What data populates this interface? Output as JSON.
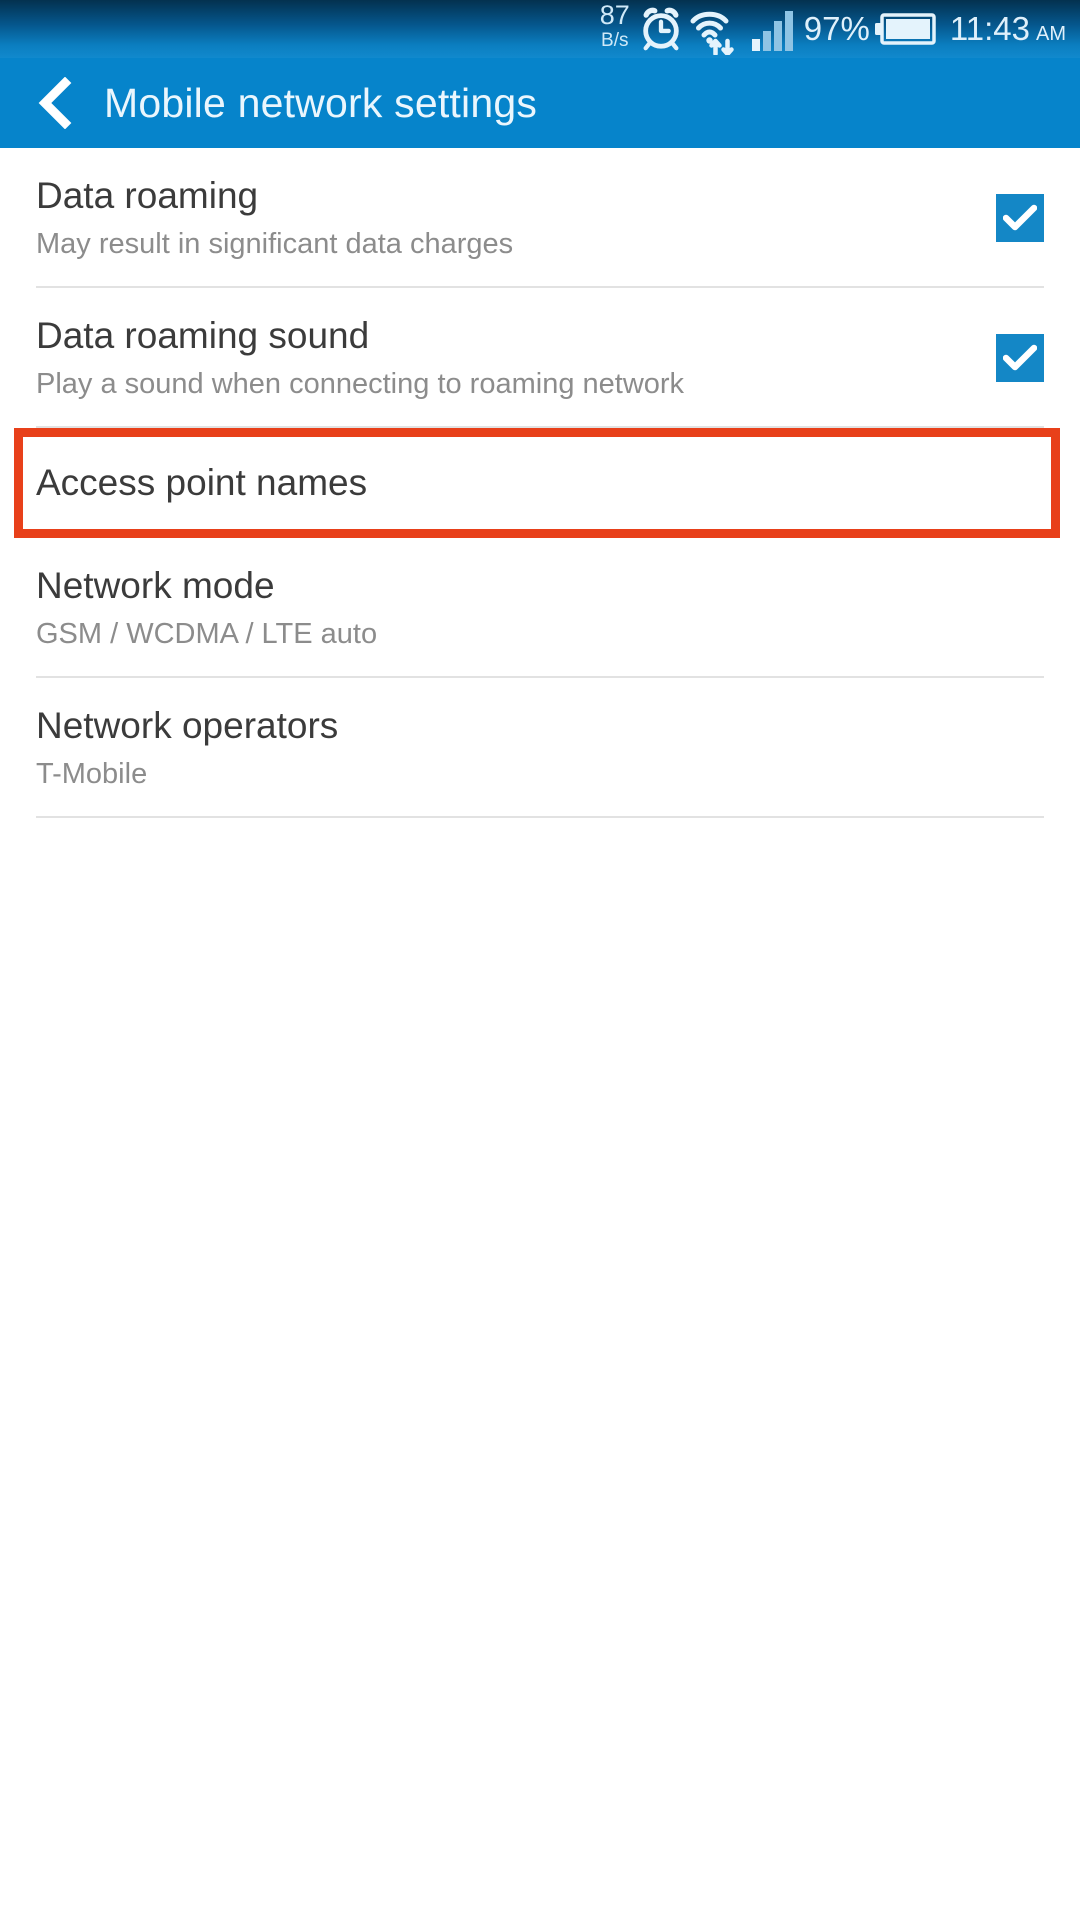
{
  "status_bar": {
    "data_speed_value": "87",
    "data_speed_unit": "B/s",
    "battery_percent": "97%",
    "time": "11:43",
    "time_period": "AM",
    "icons": [
      "alarm-icon",
      "wifi-icon",
      "signal-bars-icon",
      "battery-icon"
    ],
    "background_top_color": "#04314f",
    "background_bottom_color": "#1189cd"
  },
  "action_bar": {
    "back_icon": "back-chevron-icon",
    "title": "Mobile network settings",
    "background_color": "#0684cb"
  },
  "list": {
    "items": [
      {
        "title": "Data roaming",
        "subtitle": "May result in significant data charges",
        "control": "checkbox",
        "checked": true
      },
      {
        "title": "Data roaming sound",
        "subtitle": "Play a sound when connecting to roaming network",
        "control": "checkbox",
        "checked": true
      },
      {
        "title": "Access point names",
        "subtitle": "",
        "control": "none",
        "highlighted": true
      },
      {
        "title": "Network mode",
        "subtitle": "GSM / WCDMA / LTE auto",
        "control": "none"
      },
      {
        "title": "Network operators",
        "subtitle": "T-Mobile",
        "control": "none"
      }
    ]
  },
  "annotation": {
    "highlight_color": "#e8401a",
    "target": "Access point names"
  },
  "colors": {
    "accent_blue": "#0684cb",
    "checkbox_blue": "#1487c6",
    "divider_gray": "#e2e2e2",
    "title_text": "#3b3b3b",
    "subtitle_text": "#8c8c8c"
  }
}
